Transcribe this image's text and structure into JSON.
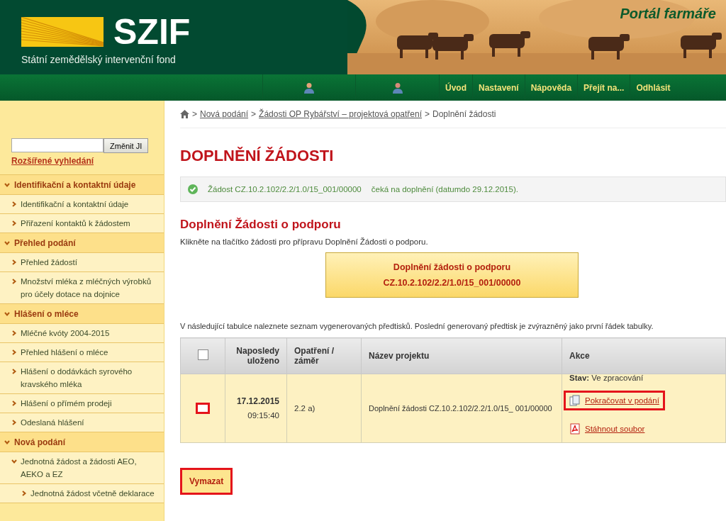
{
  "header": {
    "logo_text": "SZIF",
    "logo_subtitle": "Státní zemědělský intervenční fond",
    "portal_title": "Portál farmáře"
  },
  "nav": {
    "items": [
      "Úvod",
      "Nastavení",
      "Nápověda",
      "Přejít na...",
      "Odhlásit"
    ]
  },
  "sidebar": {
    "search": {
      "button": "Změnit JI"
    },
    "advanced_link": "Rozšířené vyhledání",
    "sections": [
      {
        "label": "Identifikační a kontaktní údaje",
        "expanded": true,
        "children": [
          {
            "label": "Identifikační a kontaktní údaje",
            "expanded": false
          },
          {
            "label": "Přiřazení kontaktů k žádostem",
            "expanded": false
          }
        ]
      },
      {
        "label": "Přehled podání",
        "expanded": true,
        "children": [
          {
            "label": "Přehled žádostí",
            "expanded": false
          },
          {
            "label": "Množství mléka z mléčných výrobků pro účely dotace na dojnice",
            "expanded": false
          }
        ]
      },
      {
        "label": "Hlášení o mléce",
        "expanded": true,
        "children": [
          {
            "label": "Mléčné kvóty 2004-2015",
            "expanded": false
          },
          {
            "label": "Přehled hlášení o mléce",
            "expanded": false
          },
          {
            "label": "Hlášení o dodávkách syrového kravského mléka",
            "expanded": false
          },
          {
            "label": "Hlášení o přímém prodeji",
            "expanded": false
          },
          {
            "label": "Odeslaná hlášení",
            "expanded": false
          }
        ]
      },
      {
        "label": "Nová podání",
        "expanded": true,
        "children": [
          {
            "label": "Jednotná žádost a žádosti AEO, AEKO a EZ",
            "expanded": true,
            "children": [
              {
                "label": "Jednotná žádost včetně deklarace",
                "expanded": false
              }
            ]
          }
        ]
      }
    ]
  },
  "breadcrumb": [
    {
      "separator": ">",
      "label": "Nová podání",
      "link": true
    },
    {
      "separator": ">",
      "label": "Žádosti OP Rybářství – projektová opatření",
      "link": true
    },
    {
      "separator": ">",
      "label": "Doplnění žádosti",
      "link": false
    }
  ],
  "page_title": "DOPLNĚNÍ ŽÁDOSTI",
  "notice": {
    "parts": [
      "Žádost CZ.10.2.102/2.2/1.0/15_001/00000",
      "čeká na doplnění (datumdo 29.12.2015)."
    ]
  },
  "section_title": "Doplnění Žádosti o podporu",
  "section_text": "Klikněte na tlačítko žádosti pro přípravu Doplnění Žádosti o podporu.",
  "big_button": {
    "lines": [
      "Doplnění žádosti o podporu",
      "CZ.10.2.102/2.2/1.0/15_001/00000"
    ]
  },
  "table_intro": "V následující tabulce naleznete seznam vygenerovaných předtisků. Poslední generovaný předtisk je zvýrazněný jako první řádek tabulky.",
  "table": {
    "select_all": {
      "checked": false
    },
    "columns": [
      "Naposledy uloženo",
      "Opatření / záměr",
      "Název projektu",
      "Akce"
    ],
    "rows": [
      {
        "checked": false,
        "highlighted": true,
        "date": "17.12.2015",
        "time": "09:15:40",
        "measure": "2.2 a)",
        "project": "Doplnění žádosti CZ.10.2.102/2.2/1.0/15_ 001/00000",
        "status_label": "Stav:",
        "status": "Ve zpracování",
        "actions": [
          {
            "kind": "continue",
            "label": "Pokračovat v podání",
            "highlighted": true
          },
          {
            "kind": "pdf",
            "label": "Stáhnout soubor",
            "highlighted": false
          }
        ]
      }
    ]
  },
  "delete_button": {
    "label": "Vymazat",
    "highlighted": true
  }
}
